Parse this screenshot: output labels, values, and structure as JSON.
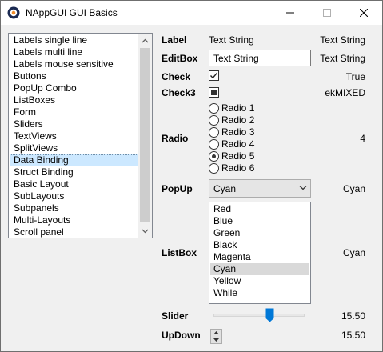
{
  "window": {
    "title": "NAppGUI GUI Basics",
    "controls": [
      "minimize-icon",
      "maximize-icon",
      "close-icon"
    ]
  },
  "nav": {
    "items": [
      "Labels single line",
      "Labels multi line",
      "Labels mouse sensitive",
      "Buttons",
      "PopUp Combo",
      "ListBoxes",
      "Form",
      "Sliders",
      "TextViews",
      "SplitViews",
      "Data Binding",
      "Struct Binding",
      "Basic Layout",
      "SubLayouts",
      "Subpanels",
      "Multi-Layouts",
      "Scroll panel"
    ],
    "selected": "Data Binding"
  },
  "form": {
    "label": {
      "label": "Label",
      "value": "Text String",
      "result": "Text String"
    },
    "editbox": {
      "label": "EditBox",
      "value": "Text String",
      "result": "Text String"
    },
    "check": {
      "label": "Check",
      "checked": true,
      "result": "True"
    },
    "check3": {
      "label": "Check3",
      "state": "mixed",
      "result": "ekMIXED"
    },
    "radio": {
      "label": "Radio",
      "options": [
        "Radio 1",
        "Radio 2",
        "Radio 3",
        "Radio 4",
        "Radio 5",
        "Radio 6"
      ],
      "selected": "Radio 5",
      "result": "4"
    },
    "popup": {
      "label": "PopUp",
      "value": "Cyan",
      "result": "Cyan"
    },
    "listbox": {
      "label": "ListBox",
      "items": [
        "Red",
        "Blue",
        "Green",
        "Black",
        "Magenta",
        "Cyan",
        "Yellow",
        "While"
      ],
      "selected": "Cyan",
      "result": "Cyan"
    },
    "slider": {
      "label": "Slider",
      "level": 0.62,
      "result": "15.50"
    },
    "updown": {
      "label": "UpDown",
      "result": "15.50"
    }
  },
  "colors": {
    "accent": "#0078d7",
    "selection": "#cce8ff",
    "listbox_selection": "#d9d9d9"
  }
}
